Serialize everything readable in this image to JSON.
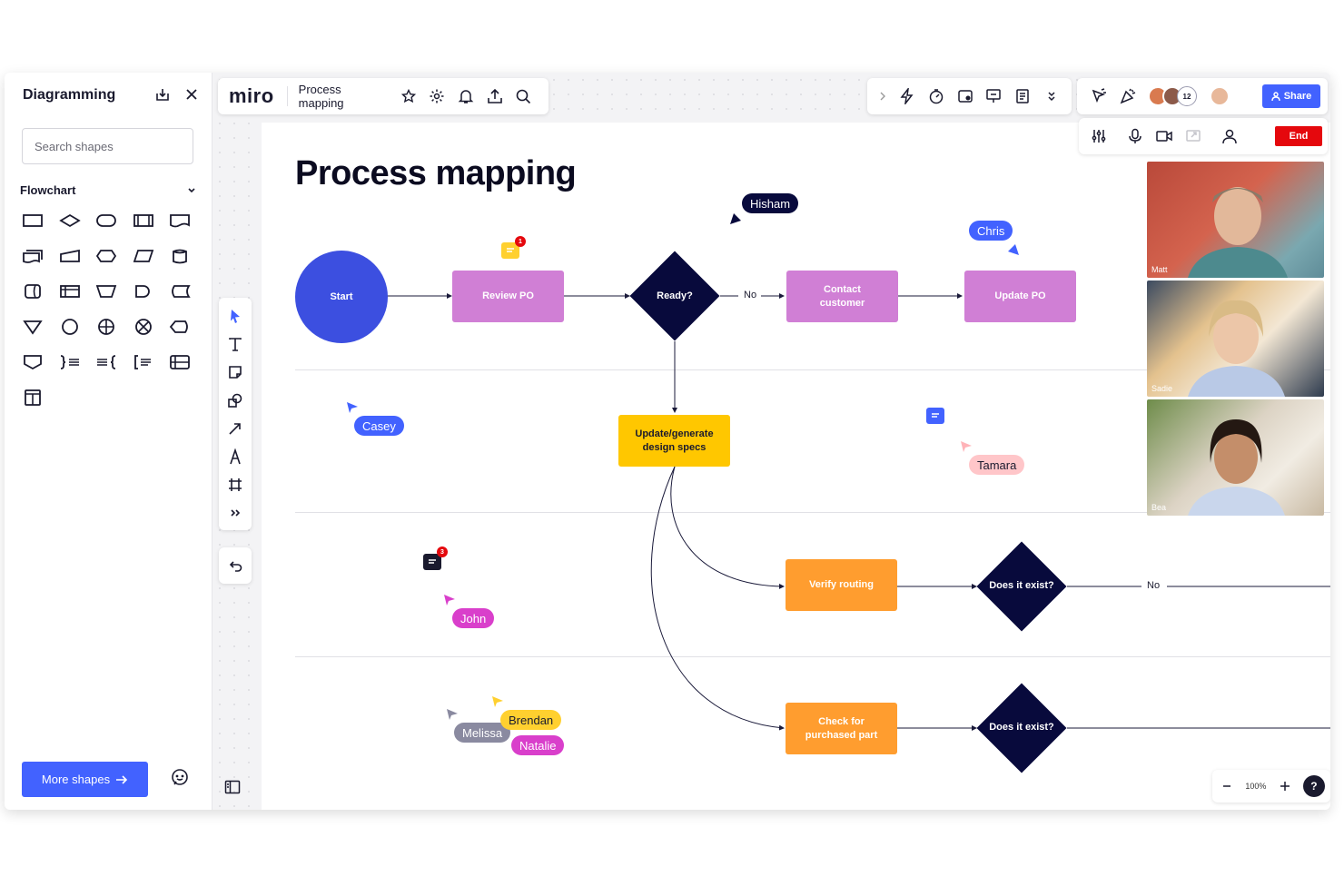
{
  "sidebar": {
    "title": "Diagramming",
    "search_placeholder": "Search shapes",
    "category": "Flowchart",
    "more_shapes_label": "More shapes"
  },
  "topbar": {
    "logo": "miro",
    "board_name": "Process mapping",
    "share_label": "Share",
    "collaborator_count": "12"
  },
  "callbar": {
    "end_label": "End"
  },
  "zoom": {
    "level": "100%",
    "help": "?"
  },
  "canvas": {
    "title": "Process mapping",
    "nodes": {
      "start": "Start",
      "review_po": "Review PO",
      "ready": "Ready?",
      "contact_customer": "Contact customer",
      "update_po": "Update PO",
      "update_specs": "Update/generate design specs",
      "verify_routing": "Verify routing",
      "does_it_exist_1": "Does it exist?",
      "check_purchased": "Check for purchased part",
      "does_it_exist_2": "Does it exist?"
    },
    "edge_labels": {
      "no_1": "No",
      "no_2": "No"
    },
    "cursors": {
      "hisham": "Hisham",
      "chris": "Chris",
      "casey": "Casey",
      "tamara": "Tamara",
      "john": "John",
      "brendan": "Brendan",
      "melissa": "Melissa",
      "natalie": "Natalie"
    },
    "comment_badges": {
      "c1": "1",
      "c2": "3"
    }
  },
  "videos": [
    {
      "name": "Matt"
    },
    {
      "name": "Sadie"
    },
    {
      "name": "Bea"
    }
  ],
  "colors": {
    "accent": "#4262ff",
    "end": "#e5080d",
    "purple_node": "#d07fd5",
    "yellow_node": "#ffc700",
    "orange_node": "#ff9d2f",
    "diamond": "#080a3c",
    "start": "#3c4fe0"
  }
}
